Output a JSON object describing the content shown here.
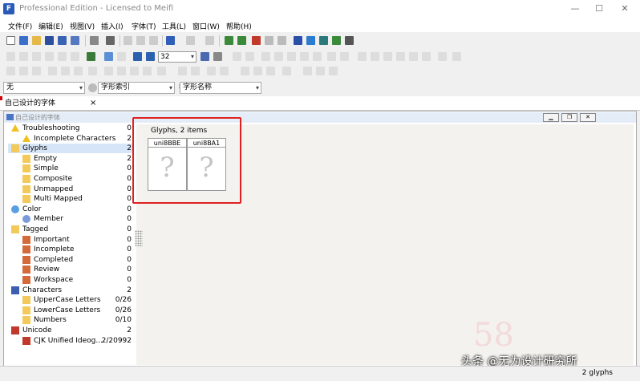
{
  "window": {
    "title": "Professional Edition - Licensed to Meifi",
    "app_icon": "F"
  },
  "menus": [
    "文件(F)",
    "编辑(E)",
    "视图(V)",
    "插入(I)",
    "字体(T)",
    "工具(L)",
    "窗口(W)",
    "帮助(H)"
  ],
  "toolbar": {
    "zoom_value": "32"
  },
  "selectors": {
    "first": "无",
    "second": "字形索引",
    "third": "字形名称"
  },
  "tab": {
    "label": "自己设计的字体",
    "close": "×"
  },
  "subwindow": {
    "title": "自己设计的字体"
  },
  "tree": [
    {
      "label": "Troubleshooting",
      "count": "0",
      "level": 0,
      "icon": "warning-icon"
    },
    {
      "label": "Incomplete Characters",
      "count": "2",
      "level": 1,
      "icon": "warning-icon"
    },
    {
      "label": "Glyphs",
      "count": "2",
      "level": 0,
      "icon": "folder-icon",
      "selected": true
    },
    {
      "label": "Empty",
      "count": "2",
      "level": 1,
      "icon": "folder-icon"
    },
    {
      "label": "Simple",
      "count": "0",
      "level": 1,
      "icon": "folder-icon"
    },
    {
      "label": "Composite",
      "count": "0",
      "level": 1,
      "icon": "folder-icon"
    },
    {
      "label": "Unmapped",
      "count": "0",
      "level": 1,
      "icon": "folder-icon"
    },
    {
      "label": "Multi Mapped",
      "count": "0",
      "level": 1,
      "icon": "folder-icon"
    },
    {
      "label": "Color",
      "count": "0",
      "level": 0,
      "icon": "color-wheel-icon"
    },
    {
      "label": "Member",
      "count": "0",
      "level": 1,
      "icon": "color-ball-icon"
    },
    {
      "label": "Tagged",
      "count": "0",
      "level": 0,
      "icon": "folder-icon"
    },
    {
      "label": "Important",
      "count": "0",
      "level": 1,
      "icon": "tag-icon"
    },
    {
      "label": "Incomplete",
      "count": "0",
      "level": 1,
      "icon": "tag-icon"
    },
    {
      "label": "Completed",
      "count": "0",
      "level": 1,
      "icon": "tag-icon"
    },
    {
      "label": "Review",
      "count": "0",
      "level": 1,
      "icon": "tag-icon"
    },
    {
      "label": "Workspace",
      "count": "0",
      "level": 1,
      "icon": "tag-icon"
    },
    {
      "label": "Characters",
      "count": "2",
      "level": 0,
      "icon": "characters-icon"
    },
    {
      "label": "UpperCase Letters",
      "count": "0/26",
      "level": 1,
      "icon": "folder-icon"
    },
    {
      "label": "LowerCase Letters",
      "count": "0/26",
      "level": 1,
      "icon": "folder-icon"
    },
    {
      "label": "Numbers",
      "count": "0/10",
      "level": 1,
      "icon": "folder-icon"
    },
    {
      "label": "Unicode",
      "count": "2",
      "level": 0,
      "icon": "unicode-icon"
    },
    {
      "label": "CJK Unified Ideog...",
      "count": "2/20992",
      "level": 1,
      "icon": "unicode-icon"
    }
  ],
  "glyph_panel": {
    "header": "Glyphs, 2 items",
    "glyphs": [
      {
        "name": "uni8BBE",
        "placeholder": "?"
      },
      {
        "name": "uni8BA1",
        "placeholder": "?"
      }
    ]
  },
  "status": {
    "text": "2 glyphs"
  },
  "watermark": {
    "text": "头条 @无为设计研究所",
    "bg_text": "58"
  },
  "colors": {
    "highlight_box": "#e02020",
    "selection": "#d6e6f8",
    "glyph_bg": "#f4f2ee"
  }
}
